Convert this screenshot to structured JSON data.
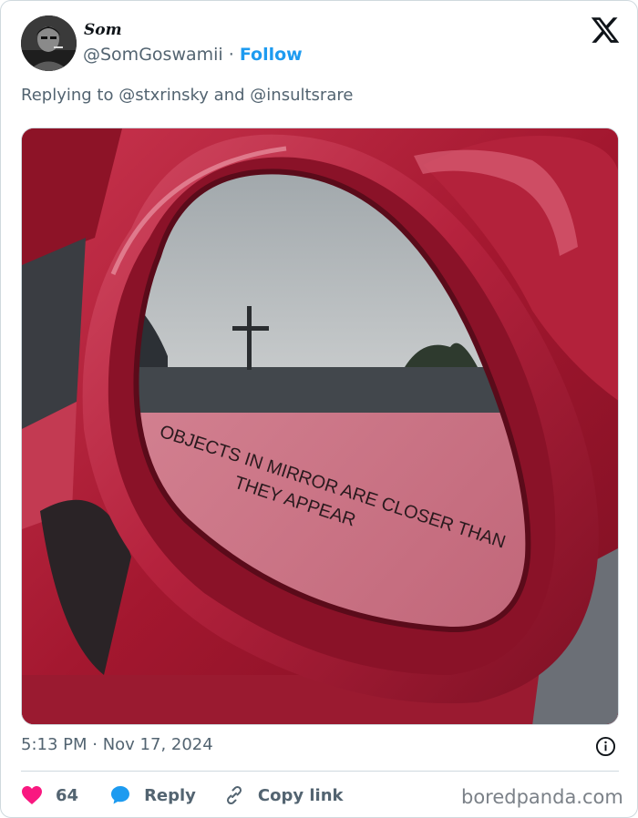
{
  "author": {
    "display_name": "Som",
    "handle": "@SomGoswamii",
    "separator": "·",
    "follow_label": "Follow"
  },
  "reply_context": {
    "prefix": "Replying to",
    "mention_1": "@stxrinsky",
    "conjunction": "and",
    "mention_2": "@insultsrare"
  },
  "media": {
    "mirror_text_line1": "OBJECTS IN MIRROR ARE CLOSER THAN",
    "mirror_text_line2": "THEY APPEAR"
  },
  "meta": {
    "timestamp": "5:13 PM · Nov 17, 2024"
  },
  "actions": {
    "like_count": "64",
    "reply_label": "Reply",
    "copy_link_label": "Copy link"
  },
  "watermark": "boredpanda.com",
  "colors": {
    "link": "#1d9bf0",
    "secondary_text": "#536471",
    "like": "#f91880",
    "reply_bubble": "#1d9bf0",
    "car_red": "#b11d36"
  },
  "icons": {
    "close": "x-logo-icon",
    "info": "info-icon",
    "like": "heart-icon",
    "reply": "speech-bubble-icon",
    "copy": "link-icon"
  }
}
